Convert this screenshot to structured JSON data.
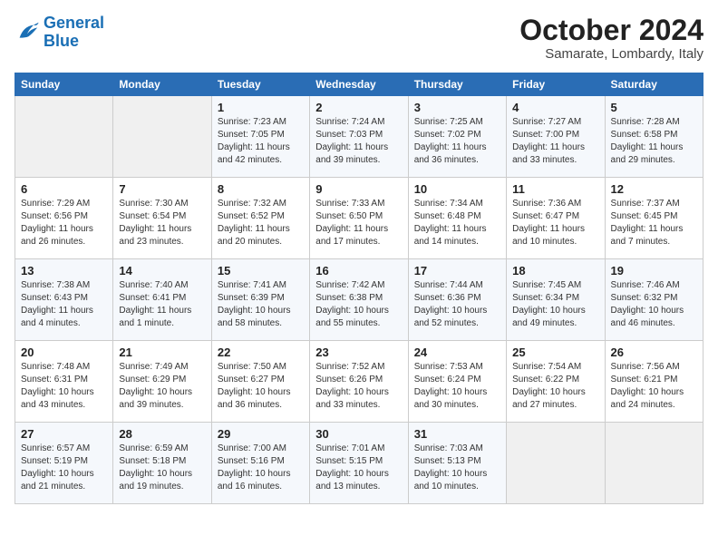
{
  "header": {
    "logo_line1": "General",
    "logo_line2": "Blue",
    "month": "October 2024",
    "location": "Samarate, Lombardy, Italy"
  },
  "weekdays": [
    "Sunday",
    "Monday",
    "Tuesday",
    "Wednesday",
    "Thursday",
    "Friday",
    "Saturday"
  ],
  "weeks": [
    [
      {
        "day": "",
        "sunrise": "",
        "sunset": "",
        "daylight": ""
      },
      {
        "day": "",
        "sunrise": "",
        "sunset": "",
        "daylight": ""
      },
      {
        "day": "1",
        "sunrise": "Sunrise: 7:23 AM",
        "sunset": "Sunset: 7:05 PM",
        "daylight": "Daylight: 11 hours and 42 minutes."
      },
      {
        "day": "2",
        "sunrise": "Sunrise: 7:24 AM",
        "sunset": "Sunset: 7:03 PM",
        "daylight": "Daylight: 11 hours and 39 minutes."
      },
      {
        "day": "3",
        "sunrise": "Sunrise: 7:25 AM",
        "sunset": "Sunset: 7:02 PM",
        "daylight": "Daylight: 11 hours and 36 minutes."
      },
      {
        "day": "4",
        "sunrise": "Sunrise: 7:27 AM",
        "sunset": "Sunset: 7:00 PM",
        "daylight": "Daylight: 11 hours and 33 minutes."
      },
      {
        "day": "5",
        "sunrise": "Sunrise: 7:28 AM",
        "sunset": "Sunset: 6:58 PM",
        "daylight": "Daylight: 11 hours and 29 minutes."
      }
    ],
    [
      {
        "day": "6",
        "sunrise": "Sunrise: 7:29 AM",
        "sunset": "Sunset: 6:56 PM",
        "daylight": "Daylight: 11 hours and 26 minutes."
      },
      {
        "day": "7",
        "sunrise": "Sunrise: 7:30 AM",
        "sunset": "Sunset: 6:54 PM",
        "daylight": "Daylight: 11 hours and 23 minutes."
      },
      {
        "day": "8",
        "sunrise": "Sunrise: 7:32 AM",
        "sunset": "Sunset: 6:52 PM",
        "daylight": "Daylight: 11 hours and 20 minutes."
      },
      {
        "day": "9",
        "sunrise": "Sunrise: 7:33 AM",
        "sunset": "Sunset: 6:50 PM",
        "daylight": "Daylight: 11 hours and 17 minutes."
      },
      {
        "day": "10",
        "sunrise": "Sunrise: 7:34 AM",
        "sunset": "Sunset: 6:48 PM",
        "daylight": "Daylight: 11 hours and 14 minutes."
      },
      {
        "day": "11",
        "sunrise": "Sunrise: 7:36 AM",
        "sunset": "Sunset: 6:47 PM",
        "daylight": "Daylight: 11 hours and 10 minutes."
      },
      {
        "day": "12",
        "sunrise": "Sunrise: 7:37 AM",
        "sunset": "Sunset: 6:45 PM",
        "daylight": "Daylight: 11 hours and 7 minutes."
      }
    ],
    [
      {
        "day": "13",
        "sunrise": "Sunrise: 7:38 AM",
        "sunset": "Sunset: 6:43 PM",
        "daylight": "Daylight: 11 hours and 4 minutes."
      },
      {
        "day": "14",
        "sunrise": "Sunrise: 7:40 AM",
        "sunset": "Sunset: 6:41 PM",
        "daylight": "Daylight: 11 hours and 1 minute."
      },
      {
        "day": "15",
        "sunrise": "Sunrise: 7:41 AM",
        "sunset": "Sunset: 6:39 PM",
        "daylight": "Daylight: 10 hours and 58 minutes."
      },
      {
        "day": "16",
        "sunrise": "Sunrise: 7:42 AM",
        "sunset": "Sunset: 6:38 PM",
        "daylight": "Daylight: 10 hours and 55 minutes."
      },
      {
        "day": "17",
        "sunrise": "Sunrise: 7:44 AM",
        "sunset": "Sunset: 6:36 PM",
        "daylight": "Daylight: 10 hours and 52 minutes."
      },
      {
        "day": "18",
        "sunrise": "Sunrise: 7:45 AM",
        "sunset": "Sunset: 6:34 PM",
        "daylight": "Daylight: 10 hours and 49 minutes."
      },
      {
        "day": "19",
        "sunrise": "Sunrise: 7:46 AM",
        "sunset": "Sunset: 6:32 PM",
        "daylight": "Daylight: 10 hours and 46 minutes."
      }
    ],
    [
      {
        "day": "20",
        "sunrise": "Sunrise: 7:48 AM",
        "sunset": "Sunset: 6:31 PM",
        "daylight": "Daylight: 10 hours and 43 minutes."
      },
      {
        "day": "21",
        "sunrise": "Sunrise: 7:49 AM",
        "sunset": "Sunset: 6:29 PM",
        "daylight": "Daylight: 10 hours and 39 minutes."
      },
      {
        "day": "22",
        "sunrise": "Sunrise: 7:50 AM",
        "sunset": "Sunset: 6:27 PM",
        "daylight": "Daylight: 10 hours and 36 minutes."
      },
      {
        "day": "23",
        "sunrise": "Sunrise: 7:52 AM",
        "sunset": "Sunset: 6:26 PM",
        "daylight": "Daylight: 10 hours and 33 minutes."
      },
      {
        "day": "24",
        "sunrise": "Sunrise: 7:53 AM",
        "sunset": "Sunset: 6:24 PM",
        "daylight": "Daylight: 10 hours and 30 minutes."
      },
      {
        "day": "25",
        "sunrise": "Sunrise: 7:54 AM",
        "sunset": "Sunset: 6:22 PM",
        "daylight": "Daylight: 10 hours and 27 minutes."
      },
      {
        "day": "26",
        "sunrise": "Sunrise: 7:56 AM",
        "sunset": "Sunset: 6:21 PM",
        "daylight": "Daylight: 10 hours and 24 minutes."
      }
    ],
    [
      {
        "day": "27",
        "sunrise": "Sunrise: 6:57 AM",
        "sunset": "Sunset: 5:19 PM",
        "daylight": "Daylight: 10 hours and 21 minutes."
      },
      {
        "day": "28",
        "sunrise": "Sunrise: 6:59 AM",
        "sunset": "Sunset: 5:18 PM",
        "daylight": "Daylight: 10 hours and 19 minutes."
      },
      {
        "day": "29",
        "sunrise": "Sunrise: 7:00 AM",
        "sunset": "Sunset: 5:16 PM",
        "daylight": "Daylight: 10 hours and 16 minutes."
      },
      {
        "day": "30",
        "sunrise": "Sunrise: 7:01 AM",
        "sunset": "Sunset: 5:15 PM",
        "daylight": "Daylight: 10 hours and 13 minutes."
      },
      {
        "day": "31",
        "sunrise": "Sunrise: 7:03 AM",
        "sunset": "Sunset: 5:13 PM",
        "daylight": "Daylight: 10 hours and 10 minutes."
      },
      {
        "day": "",
        "sunrise": "",
        "sunset": "",
        "daylight": ""
      },
      {
        "day": "",
        "sunrise": "",
        "sunset": "",
        "daylight": ""
      }
    ]
  ]
}
